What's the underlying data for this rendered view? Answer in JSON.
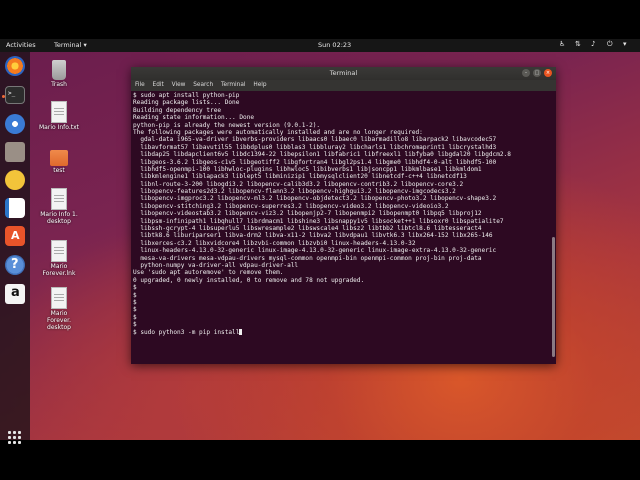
{
  "topbar": {
    "activities": "Activities",
    "app_menu": "Terminal ▾",
    "clock": "Sun 02:23"
  },
  "desktop_icons": [
    {
      "label": "Trash"
    },
    {
      "label": "Mario Info.txt"
    },
    {
      "label": "test"
    },
    {
      "label": "Mario Info 1. desktop"
    },
    {
      "label": "Mario Forever.lnk"
    },
    {
      "label": "Mario Forever. desktop"
    }
  ],
  "terminal": {
    "title": "Terminal",
    "menu": [
      "File",
      "Edit",
      "View",
      "Search",
      "Terminal",
      "Help"
    ],
    "lines": [
      "$ sudo apt install python-pip",
      "Reading package lists... Done",
      "Building dependency tree",
      "Reading state information... Done",
      "python-pip is already the newest version (9.0.1-2).",
      "The following packages were automatically installed and are no longer required:",
      "  gdal-data i965-va-driver ibverbs-providers libaacs0 libaec0 libarmadillo8 libarpack2 libavcodec57",
      "  libavformat57 libavutil55 libbdplus0 libblas3 libbluray2 libcharls1 libchromaprint1 libcrystalhd3",
      "  libdap25 libdapclient6v5 libdc1394-22 libepsilon1 libfabric1 libfreexl1 libfyba0 libgdal20 libgdcm2.8",
      "  libgeos-3.6.2 libgeos-c1v5 libgeotiff2 libgfortran4 libgl2ps1.4 libgme0 libhdf4-0-alt libhdf5-100",
      "  libhdf5-openmpi-100 libhwloc-plugins libhwloc5 libibverbs1 libjsoncpp1 libkmlbase1 libkmldom1",
      "  libkmlengine1 liblapack3 liblept5 libminizip1 libmysqlclient20 libnetcdf-c++4 libnetcdf13",
      "  libnl-route-3-200 libogdi3.2 libopencv-calib3d3.2 libopencv-contrib3.2 libopencv-core3.2",
      "  libopencv-features2d3.2 libopencv-flann3.2 libopencv-highgui3.2 libopencv-imgcodecs3.2",
      "  libopencv-imgproc3.2 libopencv-ml3.2 libopencv-objdetect3.2 libopencv-photo3.2 libopencv-shape3.2",
      "  libopencv-stitching3.2 libopencv-superres3.2 libopencv-video3.2 libopencv-videoio3.2",
      "  libopencv-videostab3.2 libopencv-viz3.2 libopenjp2-7 libopenmpi2 libopenmpt0 libpq5 libproj12",
      "  libpsm-infinipath1 libqhull7 librdmacm1 libshine3 libsnappy1v5 libsocket++1 libsoxr0 libspatialite7",
      "  libssh-gcrypt-4 libsuperlu5 libswresample2 libswscale4 libsz2 libtbb2 libtcl8.6 libtesseract4",
      "  libtk8.6 liburiparser1 libva-drm2 libva-x11-2 libva2 libvdpau1 libvtk6.3 libx264-152 libx265-146",
      "  libxerces-c3.2 libxvidcore4 libzvbi-common libzvbi0 linux-headers-4.13.0-32",
      "  linux-headers-4.13.0-32-generic linux-image-4.13.0-32-generic linux-image-extra-4.13.0-32-generic",
      "  mesa-va-drivers mesa-vdpau-drivers mysql-common openmpi-bin openmpi-common proj-bin proj-data",
      "  python-numpy va-driver-all vdpau-driver-all",
      "Use 'sudo apt autoremove' to remove them.",
      "0 upgraded, 0 newly installed, 0 to remove and 78 not upgraded.",
      "$",
      "$",
      "$",
      "$",
      "$",
      "$",
      "$ sudo python3 -m pip install"
    ]
  }
}
